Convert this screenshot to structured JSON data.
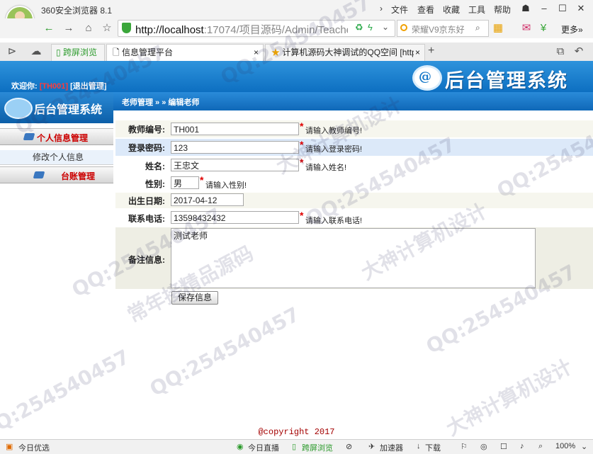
{
  "browser": {
    "app_title": "360安全浏览器 8.1",
    "menu": [
      "文件",
      "查看",
      "收藏",
      "工具",
      "帮助"
    ],
    "address": {
      "host": "http://localhost",
      "rest": ":17074/项目源码/Admin/Teacher"
    },
    "search_text": "荣耀V9京东好",
    "more_label": "更多»",
    "tabs": [
      {
        "label": "跨屏浏览"
      },
      {
        "label": "信息管理平台",
        "close": "×"
      },
      {
        "label": "计算机源码大神调试的QQ空间 [http:",
        "close": "×"
      }
    ],
    "new_tab": "+"
  },
  "header": {
    "welcome_prefix": "欢迎你:",
    "username": "[TH001]",
    "logout": "[退出管理]",
    "system_title": "后台管理系统",
    "logo_glyph": "@"
  },
  "sidebar": {
    "banner_title": "后台管理系统",
    "section_personal": "个人信息管理",
    "item_edit_personal": "修改个人信息",
    "section_account": "台账管理"
  },
  "breadcrumb": "老师管理 » » 编辑老师",
  "form": {
    "teacher_id": {
      "label": "教师编号:",
      "value": "TH001",
      "hint": "请输入教师编号!"
    },
    "password": {
      "label": "登录密码:",
      "value": "123",
      "hint": "请输入登录密码!"
    },
    "name": {
      "label": "姓名:",
      "value": "王忠文",
      "hint": "请输入姓名!"
    },
    "gender": {
      "label": "性别:",
      "value": "男",
      "hint": "请输入性别!"
    },
    "birthday": {
      "label": "出生日期:",
      "value": "2017-04-12"
    },
    "phone": {
      "label": "联系电话:",
      "value": "13598432432",
      "hint": "请输入联系电话!"
    },
    "remark": {
      "label": "备注信息:",
      "value": "测试老师"
    },
    "required_mark": "*",
    "save_label": "保存信息"
  },
  "copyright": "@copyright 2017",
  "statusbar": {
    "left": "今日优选",
    "items": [
      "今日直播",
      "跨屏浏览",
      "加速器",
      "下载"
    ],
    "zoom": "100%"
  },
  "watermarks": [
    "QQ:254540457",
    "大神计算机设计",
    "常年接精品源码"
  ],
  "colors": {
    "header_blue": "#0d6fc1",
    "required_red": "#e00000",
    "sidebar_red": "#cc0000",
    "copyright_red": "#a40000"
  }
}
